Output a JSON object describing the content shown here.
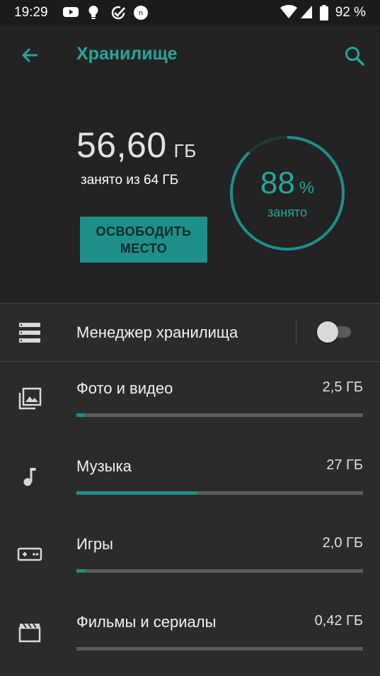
{
  "status_bar": {
    "time": "19:29",
    "battery_percent": "92 %",
    "icons": [
      "youtube-icon",
      "lightbulb-icon",
      "check-circle-icon",
      "notification-n-icon",
      "wifi-icon",
      "signal-icon",
      "battery-icon"
    ]
  },
  "header": {
    "title": "Хранилище",
    "back_icon": "arrow-back-icon",
    "search_icon": "search-icon"
  },
  "summary": {
    "used_value": "56,60",
    "used_unit": "ГБ",
    "used_sub": "занято из 64 ГБ",
    "free_button_label": "ОСВОБОДИТЬ МЕСТО",
    "percent_value": "88",
    "percent_symbol": "%",
    "percent_label": "занято",
    "percent_fraction": 0.88
  },
  "manager": {
    "label": "Менеджер хранилища",
    "toggle_on": false,
    "icon": "storage-list-icon"
  },
  "categories": [
    {
      "label": "Фото и видео",
      "size": "2,5 ГБ",
      "fraction": 0.03,
      "icon": "photo-library-icon"
    },
    {
      "label": "Музыка",
      "size": "27 ГБ",
      "fraction": 0.42,
      "icon": "music-note-icon"
    },
    {
      "label": "Игры",
      "size": "2,0 ГБ",
      "fraction": 0.03,
      "icon": "gamepad-icon"
    },
    {
      "label": "Фильмы и сериалы",
      "size": "0,42 ГБ",
      "fraction": 0.0,
      "icon": "movie-clapper-icon"
    }
  ],
  "colors": {
    "accent": "#26a69a",
    "button_bg": "#1f8f8a",
    "background": "#2b2b2b",
    "header_bg": "#232323"
  }
}
